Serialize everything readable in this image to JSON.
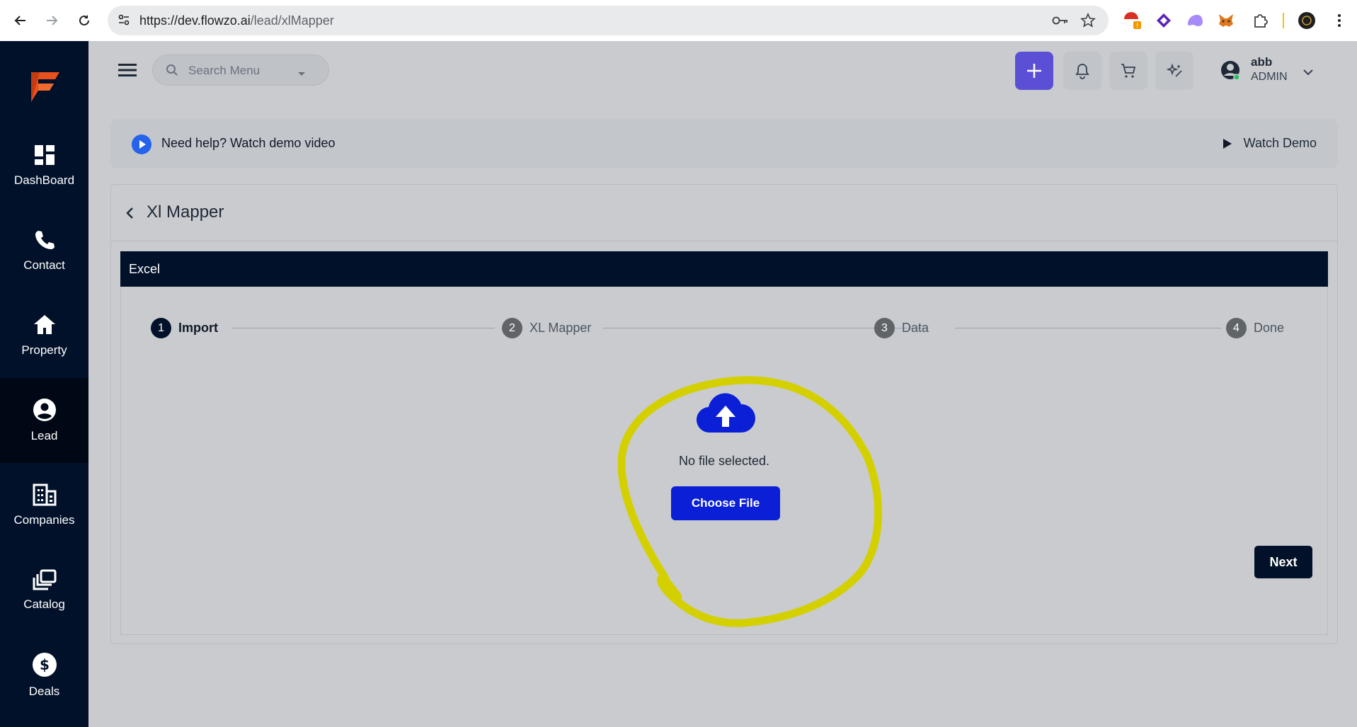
{
  "browser": {
    "url_host": "https://dev.flowzo.ai",
    "url_path": "/lead/xlMapper"
  },
  "sidebar": {
    "items": [
      {
        "label": "DashBoard",
        "icon": "dashboard-icon"
      },
      {
        "label": "Contact",
        "icon": "phone-icon"
      },
      {
        "label": "Property",
        "icon": "home-icon"
      },
      {
        "label": "Lead",
        "icon": "account-circle-icon",
        "active": true
      },
      {
        "label": "Companies",
        "icon": "building-icon"
      },
      {
        "label": "Catalog",
        "icon": "catalog-icon"
      },
      {
        "label": "Deals",
        "icon": "dollar-icon"
      }
    ]
  },
  "header": {
    "search_placeholder": "Search Menu",
    "user": {
      "name": "abb",
      "role": "ADMIN"
    }
  },
  "help": {
    "text": "Need help? Watch demo video",
    "watch_label": "Watch Demo"
  },
  "page": {
    "title": "Xl Mapper",
    "section": "Excel"
  },
  "steps": [
    {
      "num": "1",
      "label": "Import",
      "active": true
    },
    {
      "num": "2",
      "label": "XL Mapper",
      "active": false
    },
    {
      "num": "3",
      "label": "Data",
      "active": false
    },
    {
      "num": "4",
      "label": "Done",
      "active": false
    }
  ],
  "upload": {
    "status": "No file selected.",
    "button_label": "Choose File"
  },
  "actions": {
    "next_label": "Next"
  },
  "colors": {
    "sidebar": "#02112a",
    "primary_button": "#0a1fd6",
    "plus_button": "#5b4fd6",
    "annotation": "#d4d000"
  }
}
